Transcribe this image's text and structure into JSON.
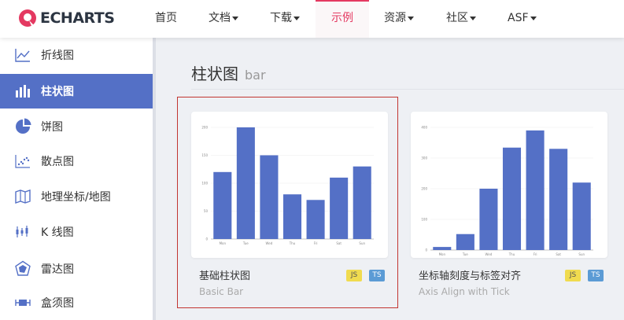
{
  "brand": {
    "name": "ECHARTS",
    "accent": "#e43961"
  },
  "nav": {
    "items": [
      {
        "label": "首页",
        "has_caret": false
      },
      {
        "label": "文档",
        "has_caret": true
      },
      {
        "label": "下载",
        "has_caret": true
      },
      {
        "label": "示例",
        "has_caret": false,
        "active": true
      },
      {
        "label": "资源",
        "has_caret": true
      },
      {
        "label": "社区",
        "has_caret": true
      },
      {
        "label": "ASF",
        "has_caret": true
      }
    ]
  },
  "sidebar": {
    "accent": "#5470c6",
    "items": [
      {
        "label": "折线图",
        "icon": "line-chart-icon"
      },
      {
        "label": "柱状图",
        "icon": "bar-chart-icon",
        "active": true
      },
      {
        "label": "饼图",
        "icon": "pie-chart-icon"
      },
      {
        "label": "散点图",
        "icon": "scatter-chart-icon"
      },
      {
        "label": "地理坐标/地图",
        "icon": "map-icon"
      },
      {
        "label": "K 线图",
        "icon": "candlestick-icon"
      },
      {
        "label": "雷达图",
        "icon": "radar-chart-icon"
      },
      {
        "label": "盒须图",
        "icon": "boxplot-icon"
      }
    ]
  },
  "section": {
    "title": "柱状图",
    "subtitle": "bar"
  },
  "cards": [
    {
      "title": "基础柱状图",
      "subtitle": "Basic Bar",
      "badges": [
        "JS",
        "TS"
      ]
    },
    {
      "title": "坐标轴刻度与标签对齐",
      "subtitle": "Axis Align with Tick",
      "badges": [
        "JS",
        "TS"
      ]
    }
  ],
  "chart_data": [
    {
      "type": "bar",
      "categories": [
        "Mon",
        "Tue",
        "Wed",
        "Thu",
        "Fri",
        "Sat",
        "Sun"
      ],
      "values": [
        120,
        200,
        150,
        80,
        70,
        110,
        130
      ],
      "ylim": [
        0,
        200
      ],
      "yticks": [
        0,
        50,
        100,
        150,
        200
      ],
      "color": "#5470c6",
      "grid": true
    },
    {
      "type": "bar",
      "categories": [
        "Mon",
        "Tue",
        "Wed",
        "Thu",
        "Fri",
        "Sat",
        "Sun"
      ],
      "values": [
        10,
        52,
        200,
        334,
        390,
        330,
        220
      ],
      "ylim": [
        0,
        400
      ],
      "yticks": [
        0,
        100,
        200,
        300,
        400
      ],
      "color": "#5470c6",
      "grid": true
    }
  ]
}
